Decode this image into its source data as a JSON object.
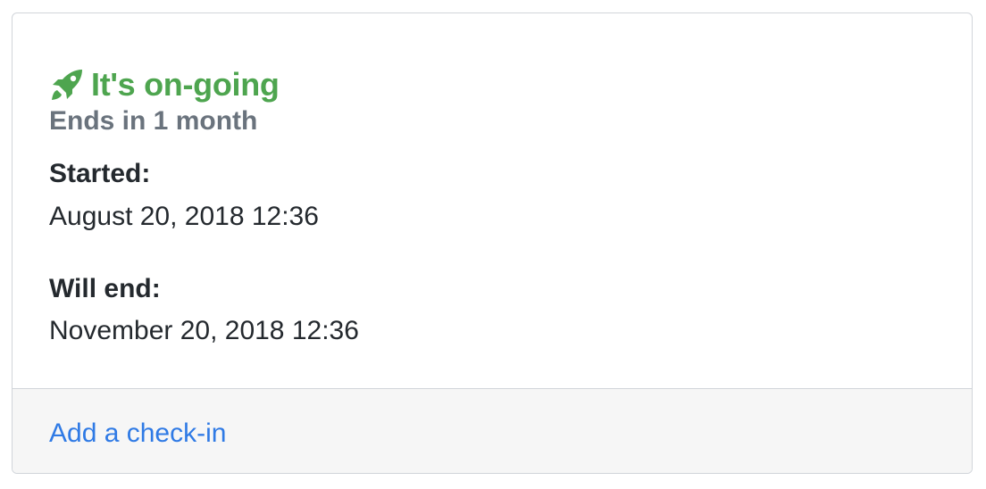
{
  "status": {
    "icon": "rocket-icon",
    "title": "It's on-going",
    "color": "#4ea54f",
    "subtitle": "Ends in 1 month"
  },
  "fields": {
    "started_label": "Started:",
    "started_value": "August 20, 2018 12:36",
    "end_label": "Will end:",
    "end_value": "November 20, 2018 12:36"
  },
  "footer": {
    "checkin_link": "Add a check-in",
    "link_color": "#2f7ae5"
  }
}
